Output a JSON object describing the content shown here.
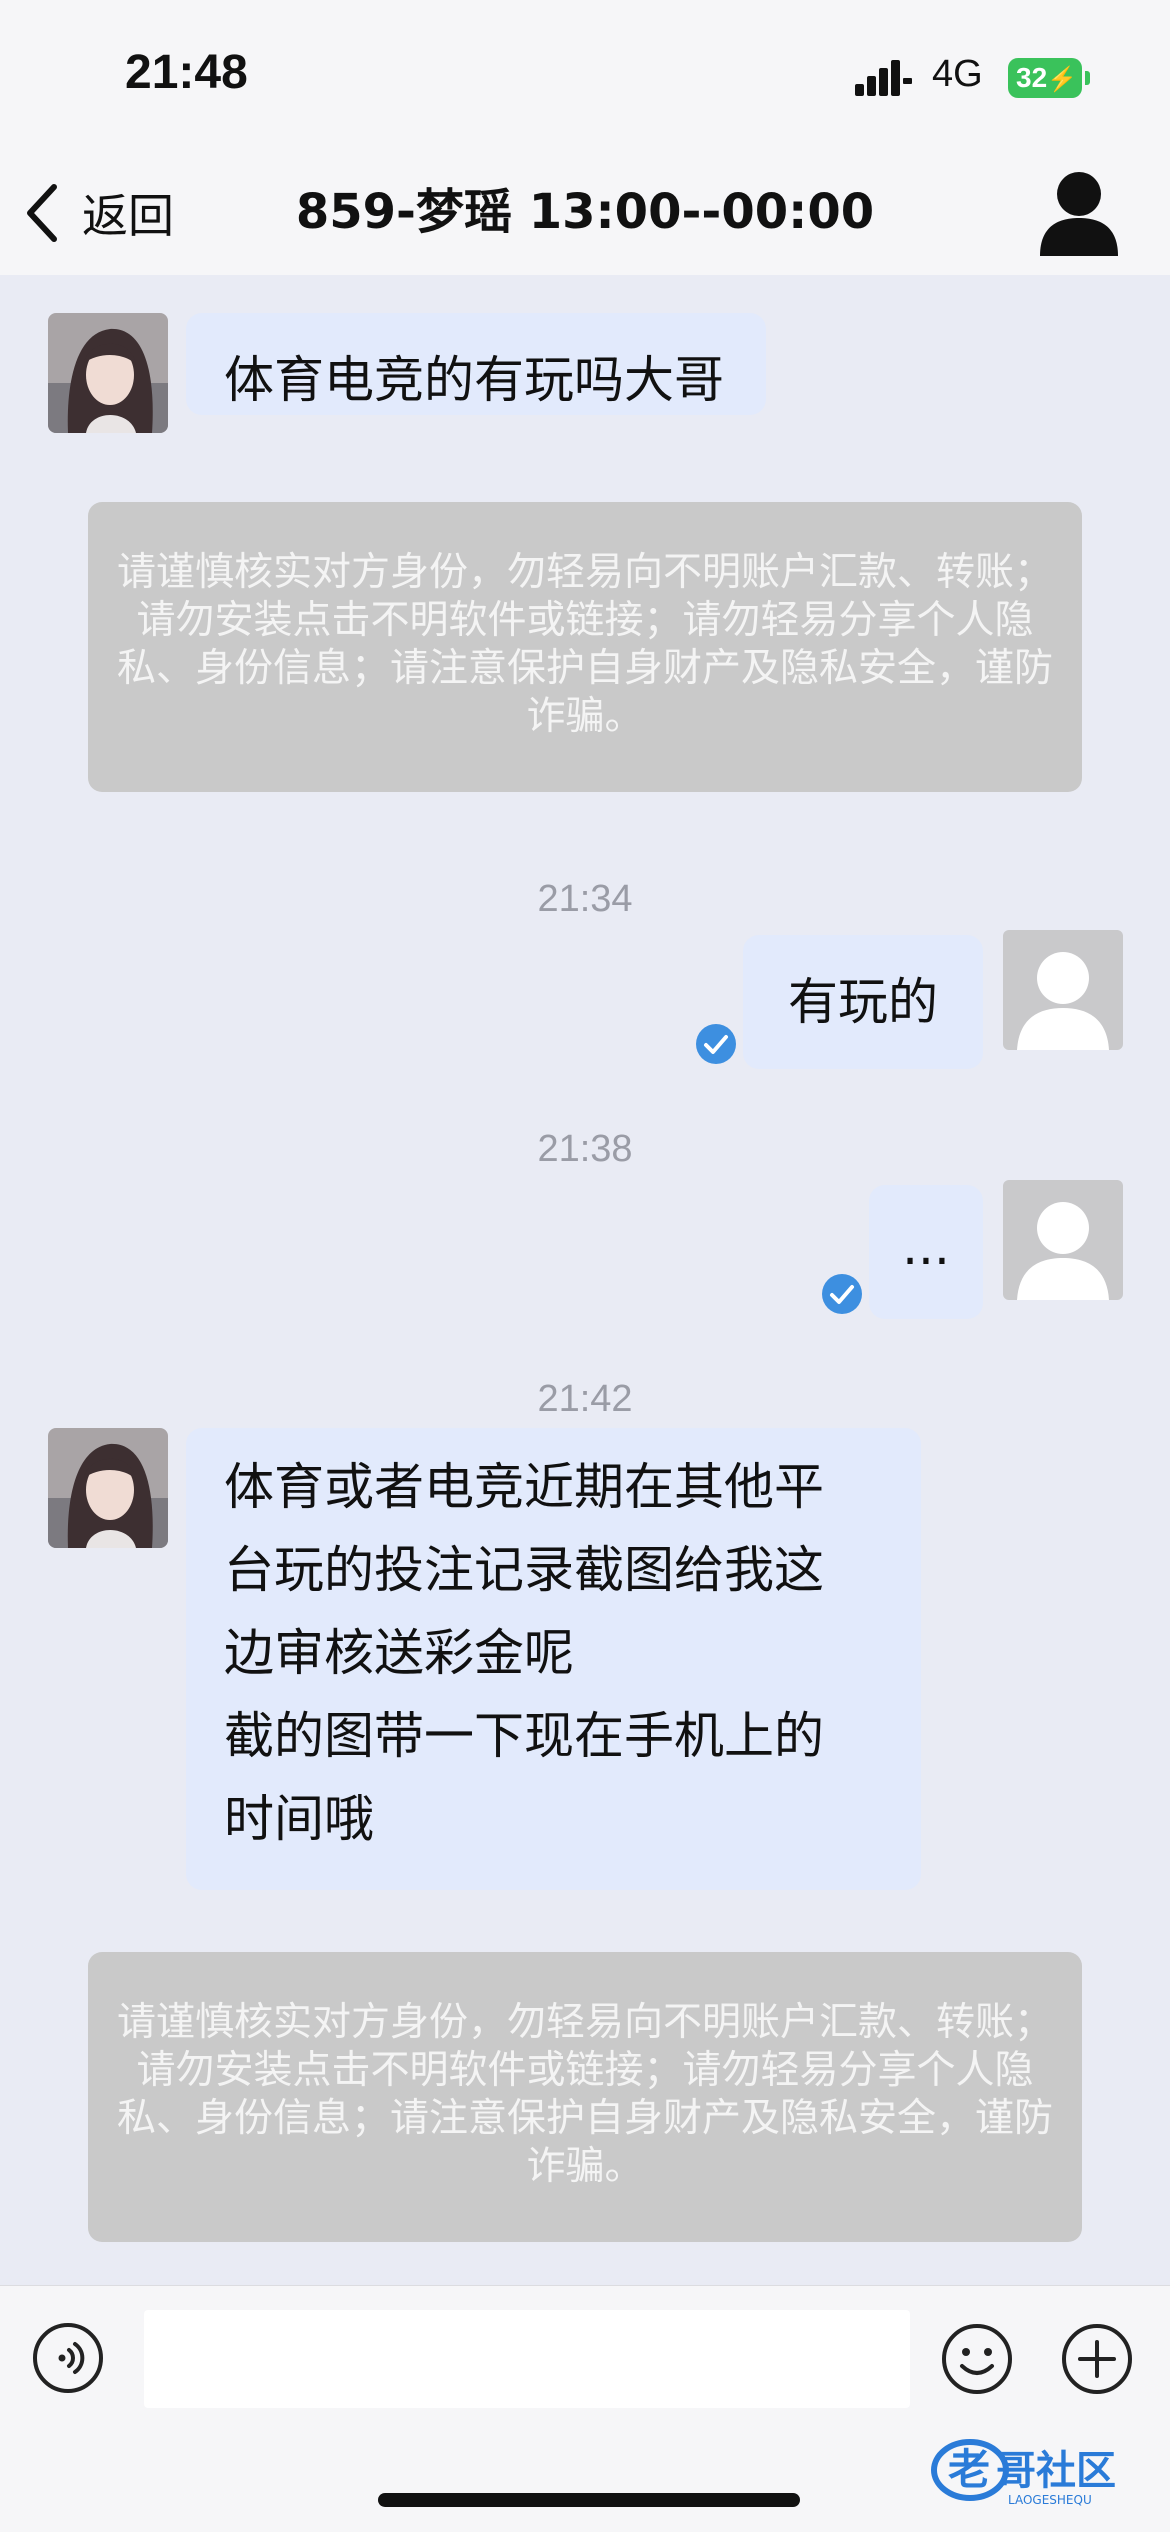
{
  "status_bar": {
    "time": "21:48",
    "network": "4G",
    "battery_level": "32",
    "icons": [
      "signal-icon",
      "battery-charging-icon"
    ]
  },
  "nav": {
    "back_label": "返回",
    "title": "859-梦瑶 13:00--00:00",
    "icons": [
      "back-chevron-icon",
      "profile-icon"
    ]
  },
  "messages": [
    {
      "type": "incoming",
      "text": "体育电竞的有玩吗大哥"
    },
    {
      "type": "notice",
      "text": "请谨慎核实对方身份，勿轻易向不明账户汇款、转账；请勿安装点击不明软件或链接；请勿轻易分享个人隐私、身份信息；请注意保护自身财产及隐私安全，谨防诈骗。"
    },
    {
      "type": "timestamp",
      "text": "21:34"
    },
    {
      "type": "outgoing",
      "text": "有玩的",
      "status": "read"
    },
    {
      "type": "timestamp",
      "text": "21:38"
    },
    {
      "type": "outgoing",
      "text": "...",
      "status": "read"
    },
    {
      "type": "timestamp",
      "text": "21:42"
    },
    {
      "type": "incoming",
      "lines": [
        "体育或者电竞近期在其他平",
        "台玩的投注记录截图给我这",
        "边审核送彩金呢",
        "截的图带一下现在手机上的",
        "时间哦"
      ]
    },
    {
      "type": "notice",
      "text": "请谨慎核实对方身份，勿轻易向不明账户汇款、转账；请勿安装点击不明软件或链接；请勿轻易分享个人隐私、身份信息；请注意保护自身财产及隐私安全，谨防诈骗。"
    }
  ],
  "input_bar": {
    "text_value": "",
    "icons": [
      "voice-icon",
      "emoji-icon",
      "plus-icon"
    ]
  },
  "watermark": {
    "text": "老哥社区",
    "sub": "LAOGESHEQU"
  },
  "colors": {
    "background": "#e9ebf4",
    "bubble": "#e2eafc",
    "notice": "#c9c9c9",
    "read_check": "#3d8fe0",
    "battery": "#3ac25b"
  }
}
